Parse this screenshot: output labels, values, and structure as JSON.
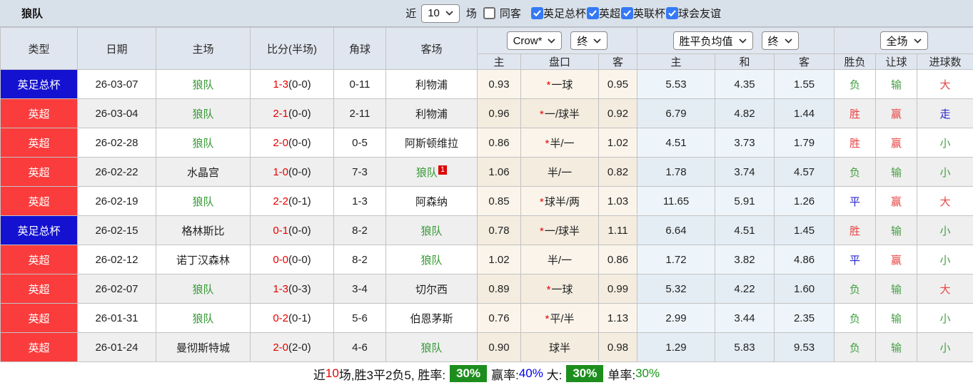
{
  "topbar": {
    "title": "狼队",
    "recent_label": "近",
    "recent_count": "10",
    "games_label": "场",
    "same_opponent": {
      "label": "同客",
      "checked": false
    },
    "league_filters": [
      {
        "label": "英足总杯",
        "checked": true
      },
      {
        "label": "英超",
        "checked": true
      },
      {
        "label": "英联杯",
        "checked": true
      },
      {
        "label": "球会友谊",
        "checked": true
      }
    ]
  },
  "table": {
    "static_headers": [
      "类型",
      "日期",
      "主场",
      "比分(半场)",
      "角球",
      "客场"
    ],
    "odds_group": {
      "bookmaker_select": "Crow*",
      "time_select": "终",
      "sub": [
        "主",
        "盘口",
        "客"
      ]
    },
    "avg_group": {
      "metric_select": "胜平负均值",
      "time_select": "终",
      "sub": [
        "主",
        "和",
        "客"
      ]
    },
    "result_group": {
      "scope_select": "全场",
      "sub": [
        "胜负",
        "让球",
        "进球数"
      ]
    },
    "rows": [
      {
        "type": "英足总杯",
        "type_color": "blue",
        "date": "26-03-07",
        "home": "狼队",
        "home_is_team": true,
        "score": "1-3",
        "half": "(0-0)",
        "corners": "0-11",
        "away": "利物浦",
        "away_is_team": false,
        "away_badge": "",
        "odds_home": "0.93",
        "handicap": "一球",
        "handicap_star": true,
        "odds_away": "0.95",
        "avg_home": "5.53",
        "avg_draw": "4.35",
        "avg_away": "1.55",
        "result_wdl": {
          "text": "负",
          "color": "green"
        },
        "result_handicap": {
          "text": "输",
          "color": "green"
        },
        "result_goals": {
          "text": "大",
          "color": "red"
        }
      },
      {
        "type": "英超",
        "type_color": "red",
        "date": "26-03-04",
        "home": "狼队",
        "home_is_team": true,
        "score": "2-1",
        "half": "(0-0)",
        "corners": "2-11",
        "away": "利物浦",
        "away_is_team": false,
        "away_badge": "",
        "odds_home": "0.96",
        "handicap": "一/球半",
        "handicap_star": true,
        "odds_away": "0.92",
        "avg_home": "6.79",
        "avg_draw": "4.82",
        "avg_away": "1.44",
        "result_wdl": {
          "text": "胜",
          "color": "red"
        },
        "result_handicap": {
          "text": "赢",
          "color": "red"
        },
        "result_goals": {
          "text": "走",
          "color": "blue"
        }
      },
      {
        "type": "英超",
        "type_color": "red",
        "date": "26-02-28",
        "home": "狼队",
        "home_is_team": true,
        "score": "2-0",
        "half": "(0-0)",
        "corners": "0-5",
        "away": "阿斯顿维拉",
        "away_is_team": false,
        "away_badge": "",
        "odds_home": "0.86",
        "handicap": "半/一",
        "handicap_star": true,
        "odds_away": "1.02",
        "avg_home": "4.51",
        "avg_draw": "3.73",
        "avg_away": "1.79",
        "result_wdl": {
          "text": "胜",
          "color": "red"
        },
        "result_handicap": {
          "text": "赢",
          "color": "red"
        },
        "result_goals": {
          "text": "小",
          "color": "green"
        }
      },
      {
        "type": "英超",
        "type_color": "red",
        "date": "26-02-22",
        "home": "水晶宫",
        "home_is_team": false,
        "score": "1-0",
        "half": "(0-0)",
        "corners": "7-3",
        "away": "狼队",
        "away_is_team": true,
        "away_badge": "1",
        "odds_home": "1.06",
        "handicap": "半/一",
        "handicap_star": false,
        "odds_away": "0.82",
        "avg_home": "1.78",
        "avg_draw": "3.74",
        "avg_away": "4.57",
        "result_wdl": {
          "text": "负",
          "color": "green"
        },
        "result_handicap": {
          "text": "输",
          "color": "green"
        },
        "result_goals": {
          "text": "小",
          "color": "green"
        }
      },
      {
        "type": "英超",
        "type_color": "red",
        "date": "26-02-19",
        "home": "狼队",
        "home_is_team": true,
        "score": "2-2",
        "half": "(0-1)",
        "corners": "1-3",
        "away": "阿森纳",
        "away_is_team": false,
        "away_badge": "",
        "odds_home": "0.85",
        "handicap": "球半/两",
        "handicap_star": true,
        "odds_away": "1.03",
        "avg_home": "11.65",
        "avg_draw": "5.91",
        "avg_away": "1.26",
        "result_wdl": {
          "text": "平",
          "color": "blue"
        },
        "result_handicap": {
          "text": "赢",
          "color": "red"
        },
        "result_goals": {
          "text": "大",
          "color": "red"
        }
      },
      {
        "type": "英足总杯",
        "type_color": "blue",
        "date": "26-02-15",
        "home": "格林斯比",
        "home_is_team": false,
        "score": "0-1",
        "half": "(0-0)",
        "corners": "8-2",
        "away": "狼队",
        "away_is_team": true,
        "away_badge": "",
        "odds_home": "0.78",
        "handicap": "一/球半",
        "handicap_star": true,
        "odds_away": "1.11",
        "avg_home": "6.64",
        "avg_draw": "4.51",
        "avg_away": "1.45",
        "result_wdl": {
          "text": "胜",
          "color": "red"
        },
        "result_handicap": {
          "text": "输",
          "color": "green"
        },
        "result_goals": {
          "text": "小",
          "color": "green"
        }
      },
      {
        "type": "英超",
        "type_color": "red",
        "date": "26-02-12",
        "home": "诺丁汉森林",
        "home_is_team": false,
        "score": "0-0",
        "half": "(0-0)",
        "corners": "8-2",
        "away": "狼队",
        "away_is_team": true,
        "away_badge": "",
        "odds_home": "1.02",
        "handicap": "半/一",
        "handicap_star": false,
        "odds_away": "0.86",
        "avg_home": "1.72",
        "avg_draw": "3.82",
        "avg_away": "4.86",
        "result_wdl": {
          "text": "平",
          "color": "blue"
        },
        "result_handicap": {
          "text": "赢",
          "color": "red"
        },
        "result_goals": {
          "text": "小",
          "color": "green"
        }
      },
      {
        "type": "英超",
        "type_color": "red",
        "date": "26-02-07",
        "home": "狼队",
        "home_is_team": true,
        "score": "1-3",
        "half": "(0-3)",
        "corners": "3-4",
        "away": "切尔西",
        "away_is_team": false,
        "away_badge": "",
        "odds_home": "0.89",
        "handicap": "一球",
        "handicap_star": true,
        "odds_away": "0.99",
        "avg_home": "5.32",
        "avg_draw": "4.22",
        "avg_away": "1.60",
        "result_wdl": {
          "text": "负",
          "color": "green"
        },
        "result_handicap": {
          "text": "输",
          "color": "green"
        },
        "result_goals": {
          "text": "大",
          "color": "red"
        }
      },
      {
        "type": "英超",
        "type_color": "red",
        "date": "26-01-31",
        "home": "狼队",
        "home_is_team": true,
        "score": "0-2",
        "half": "(0-1)",
        "corners": "5-6",
        "away": "伯恩茅斯",
        "away_is_team": false,
        "away_badge": "",
        "odds_home": "0.76",
        "handicap": "平/半",
        "handicap_star": true,
        "odds_away": "1.13",
        "avg_home": "2.99",
        "avg_draw": "3.44",
        "avg_away": "2.35",
        "result_wdl": {
          "text": "负",
          "color": "green"
        },
        "result_handicap": {
          "text": "输",
          "color": "green"
        },
        "result_goals": {
          "text": "小",
          "color": "green"
        }
      },
      {
        "type": "英超",
        "type_color": "red",
        "date": "26-01-24",
        "home": "曼彻斯特城",
        "home_is_team": false,
        "score": "2-0",
        "half": "(2-0)",
        "corners": "4-6",
        "away": "狼队",
        "away_is_team": true,
        "away_badge": "",
        "odds_home": "0.90",
        "handicap": "球半",
        "handicap_star": false,
        "odds_away": "0.98",
        "avg_home": "1.29",
        "avg_draw": "5.83",
        "avg_away": "9.53",
        "result_wdl": {
          "text": "负",
          "color": "green"
        },
        "result_handicap": {
          "text": "输",
          "color": "green"
        },
        "result_goals": {
          "text": "小",
          "color": "green"
        }
      }
    ]
  },
  "footer": {
    "segments": [
      {
        "text": "近",
        "style": "plain"
      },
      {
        "text": "10",
        "style": "red"
      },
      {
        "text": "场,胜3平2负5, 胜率:",
        "style": "plain"
      },
      {
        "text": "30%",
        "style": "badge"
      },
      {
        "text": "赢率:",
        "style": "plain"
      },
      {
        "text": "40%",
        "style": "blue"
      },
      {
        "text": " 大:",
        "style": "plain"
      },
      {
        "text": "30%",
        "style": "badge"
      },
      {
        "text": "单率:",
        "style": "plain"
      },
      {
        "text": "30%",
        "style": "green"
      }
    ]
  },
  "colors": {
    "cup_blue": "#1412d0",
    "league_red": "#fa3c3c",
    "team_green": "#339933",
    "score_red": "#e60000",
    "win_red": "#e84444",
    "lose_green": "#44a044",
    "draw_blue": "#2323cc",
    "badge_green": "#1d8e1d",
    "topbar_bg": "#d8e0ea",
    "header_bg": "#e0e6ef",
    "odds_col_bg": "#faf4ea",
    "avg_col_bg": "#edf5fa"
  }
}
